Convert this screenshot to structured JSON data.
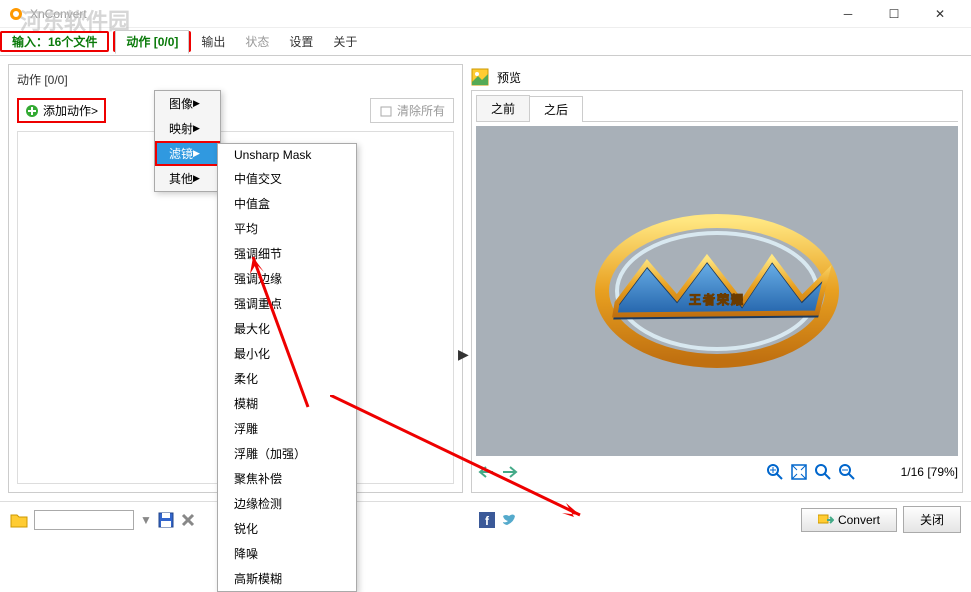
{
  "window": {
    "title": "XnConvert"
  },
  "watermark": "河东软件园",
  "tabs": {
    "input": "输入：16个文件",
    "action": "动作 [0/0]",
    "output": "输出",
    "status": "状态",
    "settings": "设置",
    "about": "关于"
  },
  "left": {
    "header": "动作  [0/0]",
    "addaction": "添加动作>",
    "clearall": "清除所有"
  },
  "menu1": {
    "image": "图像",
    "map": "映射",
    "filter": "滤镜",
    "other": "其他"
  },
  "menu2": {
    "items": [
      "Unsharp Mask",
      "中值交叉",
      "中值盒",
      "平均",
      "强调细节",
      "强调边缘",
      "强调重点",
      "最大化",
      "最小化",
      "柔化",
      "模糊",
      "浮雕",
      "浮雕（加强）",
      "聚焦补偿",
      "边缘检测",
      "锐化",
      "降噪",
      "高斯模糊"
    ]
  },
  "preview": {
    "label": "预览",
    "before": "之前",
    "after": "之后",
    "status": "1/16  [79%]"
  },
  "footer": {
    "convert": "Convert",
    "close": "关闭"
  }
}
